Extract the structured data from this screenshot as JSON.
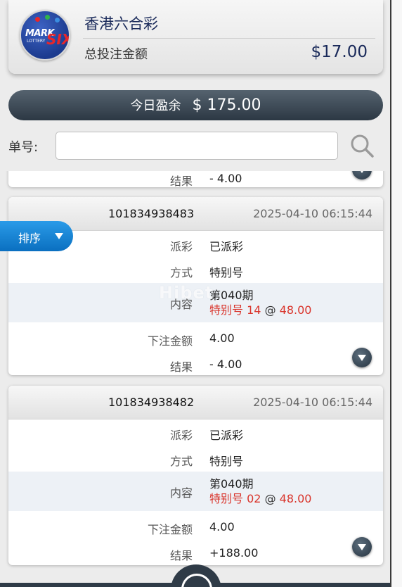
{
  "header": {
    "title": "香港六合彩",
    "total_label": "总投注金额",
    "total_amount": "$17.00",
    "logo_text": {
      "mark": "MARK",
      "lottery": "LOTTERY",
      "six": "SIX"
    }
  },
  "profit": {
    "label": "今日盈余",
    "value": "$ 175.00"
  },
  "search": {
    "label": "单号:",
    "value": "",
    "placeholder": ""
  },
  "sort": {
    "label": "排序"
  },
  "field_labels": {
    "status": "派彩",
    "mode": "方式",
    "content": "内容",
    "bet_amount": "下注金额",
    "result": "结果"
  },
  "partial_card": {
    "result_label": "结果",
    "result": "- 4.00"
  },
  "orders": [
    {
      "id": "101834938483",
      "time": "2025-04-10 06:15:44",
      "status": "已派彩",
      "mode": "特别号",
      "period": "第040期",
      "pick_type": "特别号",
      "pick_number": "14",
      "at": "@",
      "odds": "48.00",
      "bet_amount": "4.00",
      "result": "- 4.00",
      "result_color": "#d9342b"
    },
    {
      "id": "101834938482",
      "time": "2025-04-10 06:15:44",
      "status": "已派彩",
      "mode": "特别号",
      "period": "第040期",
      "pick_type": "特别号",
      "pick_number": "02",
      "at": "@",
      "odds": "48.00",
      "bet_amount": "4.00",
      "result": "+188.00",
      "result_color": "#1ea152"
    }
  ],
  "watermark": "Hibet",
  "colors": {
    "accent_blue": "#0a6fc0",
    "loss_red": "#d9342b",
    "win_green": "#1ea152",
    "dark_slate": "#2c3844"
  },
  "icons": {
    "search": "search-icon",
    "expand": "chevron-down-icon",
    "sort": "caret-down-icon",
    "refresh": "refresh-icon"
  }
}
